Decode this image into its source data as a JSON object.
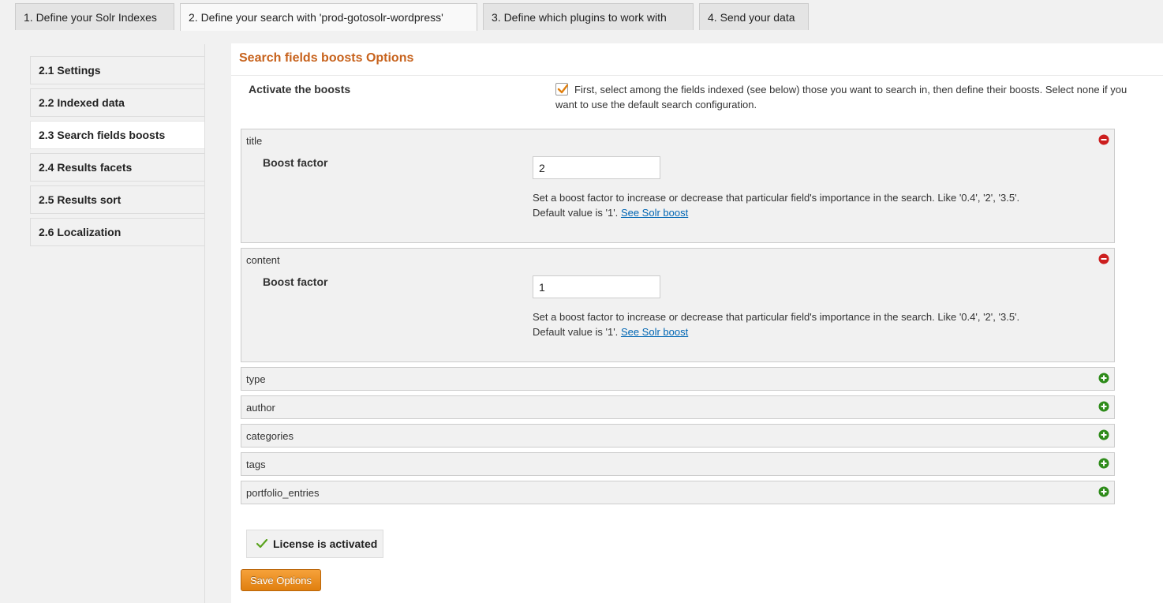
{
  "tabs": [
    {
      "label": "1. Define your Solr Indexes"
    },
    {
      "label": "2. Define your search with 'prod-gotosolr-wordpress'"
    },
    {
      "label": "3. Define which plugins to work with"
    },
    {
      "label": "4. Send your data"
    }
  ],
  "sidebar": {
    "items": [
      {
        "label": "2.1 Settings"
      },
      {
        "label": "2.2 Indexed data"
      },
      {
        "label": "2.3 Search fields boosts"
      },
      {
        "label": "2.4 Results facets"
      },
      {
        "label": "2.5 Results sort"
      },
      {
        "label": "2.6 Localization"
      }
    ]
  },
  "main": {
    "title": "Search fields boosts Options",
    "activate_label": "Activate the boosts",
    "activate_checked": true,
    "activate_desc": "First, select among the fields indexed (see below) those you want to search in, then define their boosts. Select none if you want to use the default search configuration.",
    "boost_label": "Boost factor",
    "boost_desc": "Set a boost factor to increase or decrease that particular field's importance in the search. Like '0.4', '2', '3.5'. Default value is '1'.",
    "boost_link": "See Solr boost",
    "expanded_fields": [
      {
        "name": "title",
        "value": "2"
      },
      {
        "name": "content",
        "value": "1"
      }
    ],
    "collapsed_fields": [
      {
        "name": "type"
      },
      {
        "name": "author"
      },
      {
        "name": "categories"
      },
      {
        "name": "tags"
      },
      {
        "name": "portfolio_entries"
      }
    ],
    "license_label": "License is activated",
    "save_label": "Save Options"
  },
  "colors": {
    "accent_title": "#c7621c",
    "save_button": "#f09a2f",
    "remove_icon": "#cc1f1f",
    "add_icon": "#2e8b1a",
    "link": "#0066b4"
  },
  "icons": {
    "remove": "minus-circle-icon",
    "add": "plus-circle-icon",
    "license": "checkmark-icon",
    "checkbox": "checkbox-check-icon"
  }
}
